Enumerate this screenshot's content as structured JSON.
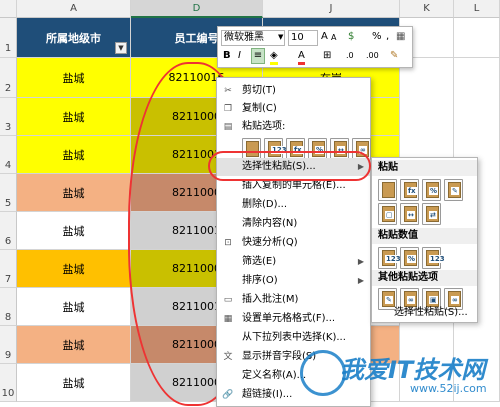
{
  "columns": {
    "row_corner": "",
    "A": "A",
    "D": "D",
    "J": "J",
    "K": "K",
    "L": "L"
  },
  "header_row": {
    "rownum": "1",
    "col_a": "所属地级市",
    "col_d": "员工编号",
    "col_j": ""
  },
  "rows": [
    {
      "num": "2",
      "city": "盐城",
      "id": "82110016",
      "j": "在岗"
    },
    {
      "num": "3",
      "city": "盐城",
      "id": "8211000",
      "j": ""
    },
    {
      "num": "4",
      "city": "盐城",
      "id": "8211001",
      "j": ""
    },
    {
      "num": "5",
      "city": "盐城",
      "id": "8211000",
      "j": ""
    },
    {
      "num": "6",
      "city": "盐城",
      "id": "8211001",
      "j": ""
    },
    {
      "num": "7",
      "city": "盐城",
      "id": "8211000",
      "j": ""
    },
    {
      "num": "8",
      "city": "盐城",
      "id": "8211001",
      "j": ""
    },
    {
      "num": "9",
      "city": "盐城",
      "id": "8211000",
      "j": ""
    },
    {
      "num": "10",
      "city": "盐城",
      "id": "8211000",
      "j": ""
    }
  ],
  "colors": {
    "yellow": "#ffff00",
    "orange": "#f4b183",
    "gold": "#ffc000",
    "white": "#ffffff",
    "olive": "#c9c000",
    "brown": "#c6896a",
    "gray": "#d0d0d0",
    "header_blue": "#1f4e79",
    "accent_red": "#e33333"
  },
  "minibar": {
    "font": "微软雅黑",
    "size": "10",
    "bold": "B",
    "italic": "I",
    "percent": "%",
    "comma": ","
  },
  "context_menu": {
    "cut": "剪切(T)",
    "copy": "复制(C)",
    "paste_options": "粘贴选项:",
    "paste_special": "选择性粘贴(S)...",
    "insert_copied": "插入复制的单元格(E)...",
    "delete": "删除(D)...",
    "clear": "清除内容(N)",
    "quick_analysis": "快速分析(Q)",
    "filter": "筛选(E)",
    "sort": "排序(O)",
    "insert_comment": "插入批注(M)",
    "format_cells": "设置单元格格式(F)...",
    "pick_list": "从下拉列表中选择(K)...",
    "phonetic": "显示拼音字段(S)",
    "define_name": "定义名称(A)...",
    "hyperlink": "超链接(I)..."
  },
  "submenu": {
    "paste": "粘贴",
    "paste_values": "粘贴数值",
    "other_paste": "其他粘贴选项",
    "paste_special": "选择性粘贴(S)..."
  },
  "watermark": {
    "main": "我爱IT技术网",
    "url": "www.52ij.com"
  }
}
